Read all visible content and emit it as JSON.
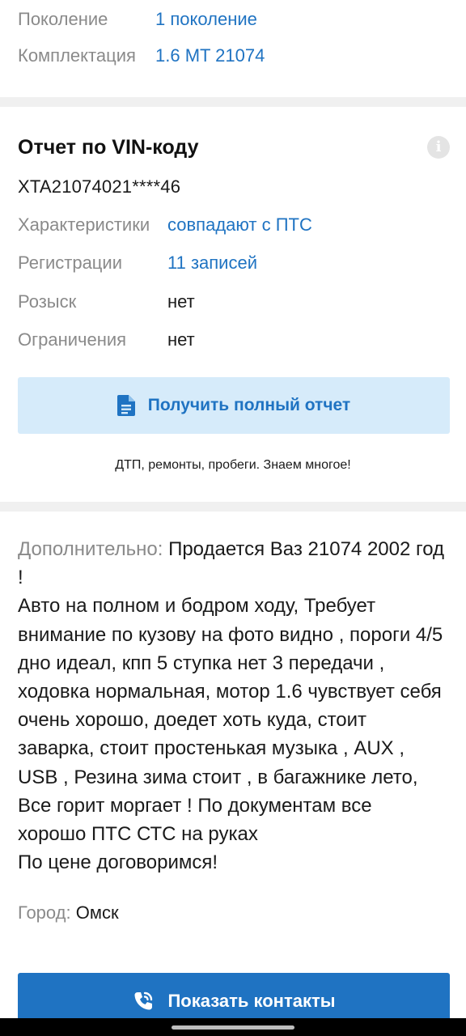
{
  "car_info": {
    "generation": {
      "key": "Поколение",
      "value": "1 поколение"
    },
    "trim": {
      "key": "Комплектация",
      "value": "1.6 MT 21074"
    }
  },
  "vin_report": {
    "title": "Отчет по VIN-коду",
    "info_icon": "i",
    "vin": "XTA21074021****46",
    "rows": [
      {
        "key": "Характеристики",
        "value": "совпадают с ПТС"
      },
      {
        "key": "Регистрации",
        "value": "11 записей"
      },
      {
        "key": "Розыск",
        "value": "нет"
      },
      {
        "key": "Ограничения",
        "value": "нет"
      }
    ],
    "button_label": "Получить полный отчет",
    "button_icon": "document-icon",
    "hint": "ДТП, ремонты, пробеги. Знаем многое!"
  },
  "description": {
    "label": "Дополнительно: ",
    "text": "Продается Ваз 21074 2002 год !\nАвто на полном и бодром ходу, Требует внимание по кузову на фото видно , пороги 4/5 дно идеал, кпп 5 ступка нет 3 передачи , ходовка нормальная, мотор 1.6 чувствует себя очень хорошо, доедет хоть куда, стоит заварка, стоит простенькая музыка , AUX , USB , Резина зима стоит , в багажнике лето, Все горит моргает ! По документам все хорошо ПТС СТС на руках\nПо цене договоримся!"
  },
  "city": {
    "key": "Город: ",
    "value": "Омск"
  },
  "contacts": {
    "button_label": "Показать контакты",
    "icon": "phone-icon"
  },
  "colors": {
    "accent": "#1f73c2",
    "button_light": "#d6ebfa",
    "muted": "#8a8a8a",
    "separator": "#f0f0f0"
  }
}
